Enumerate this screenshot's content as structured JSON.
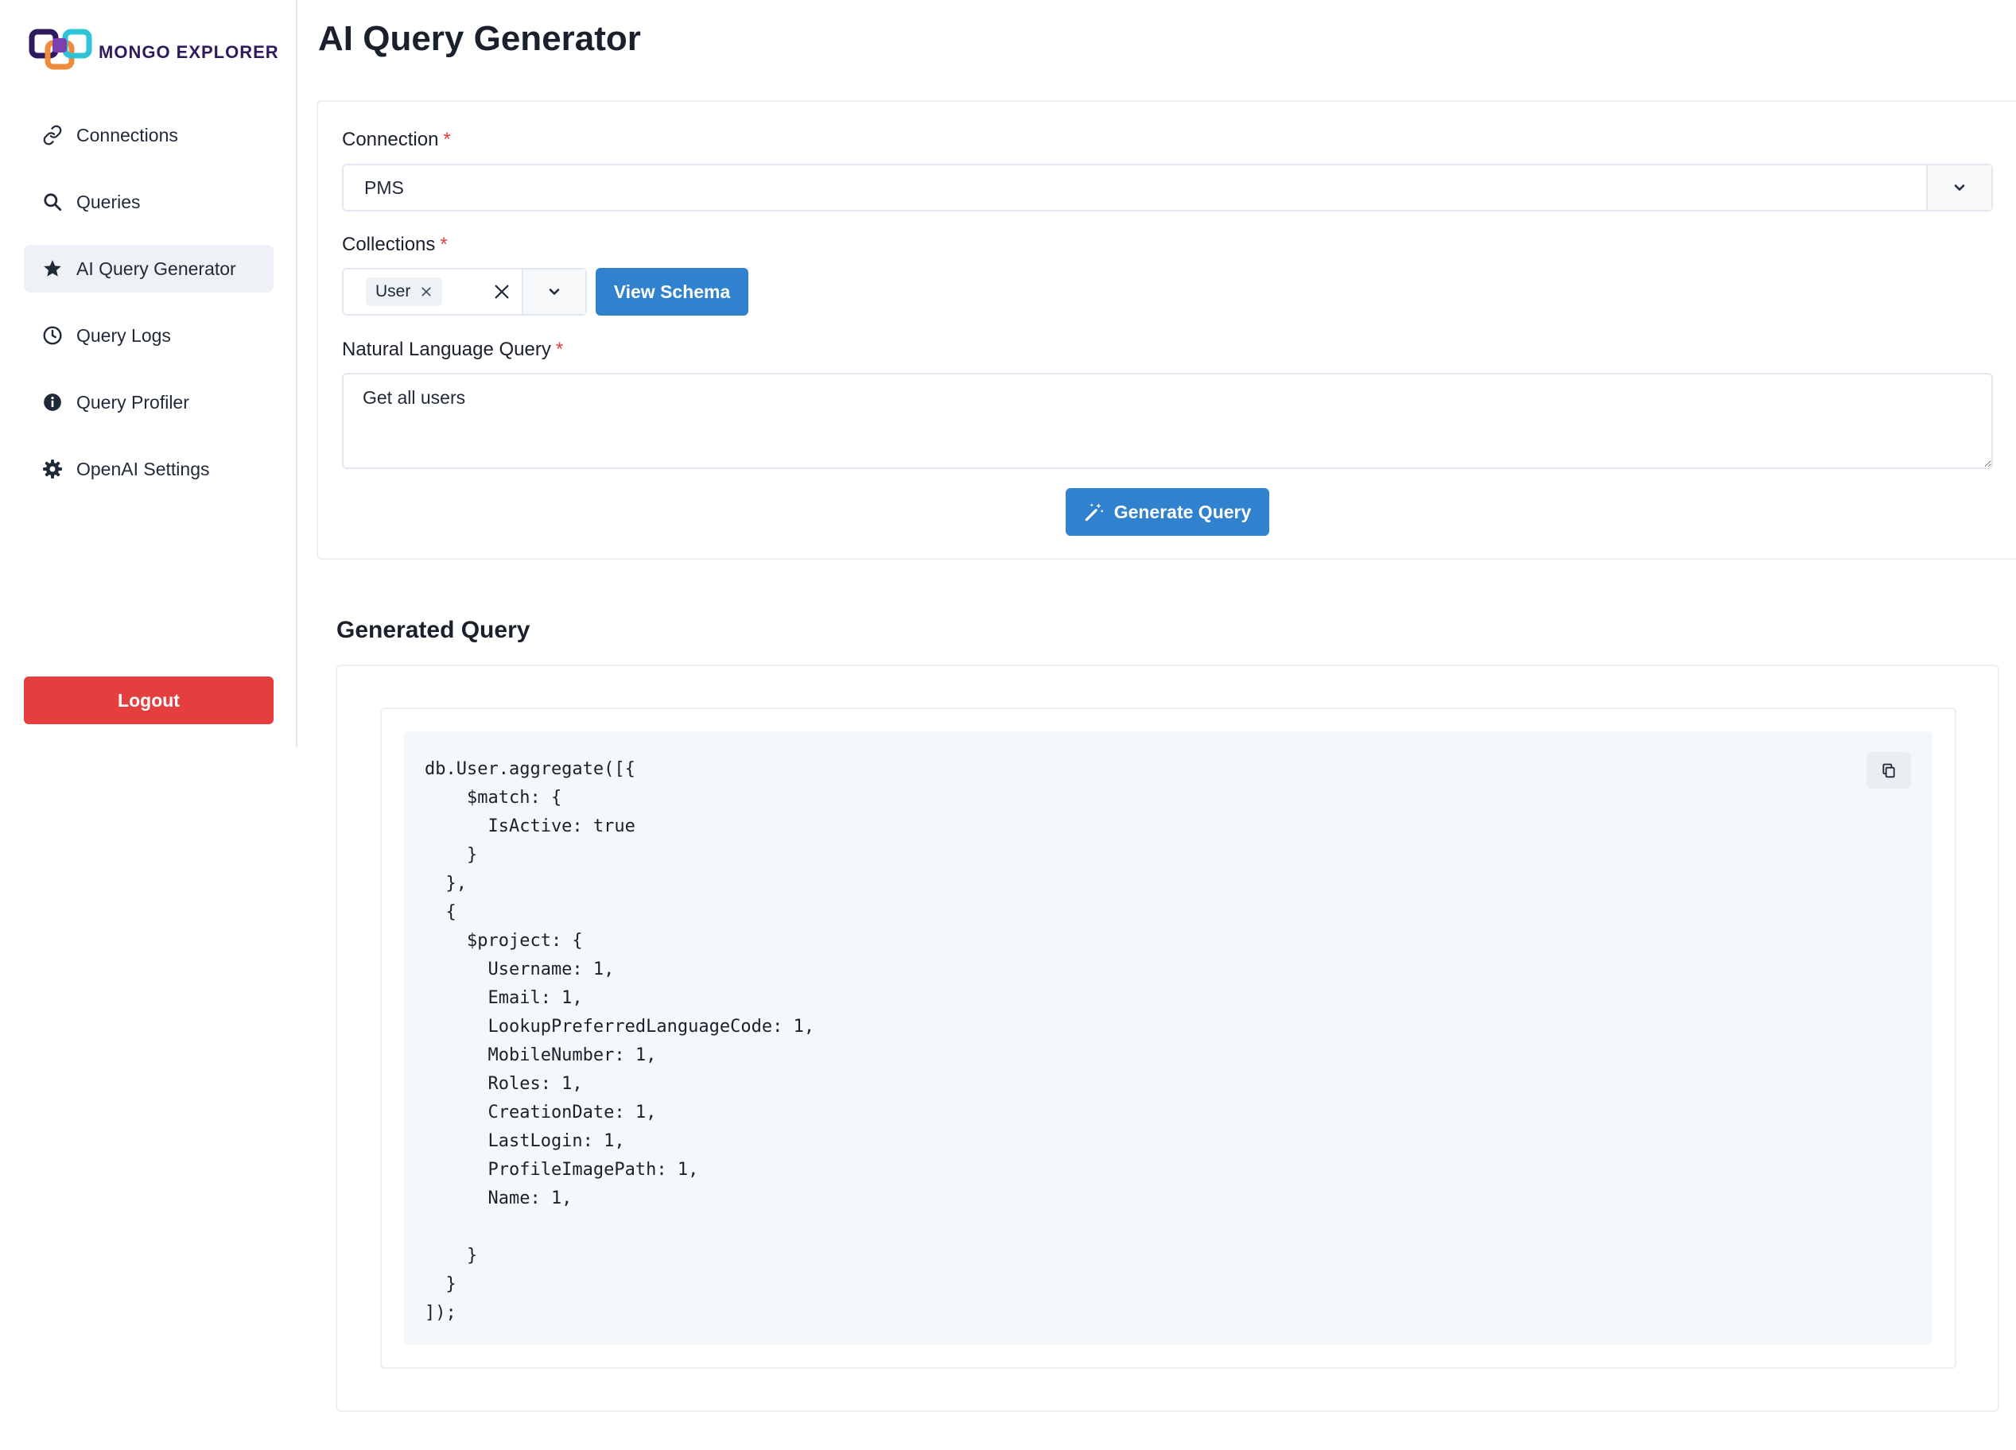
{
  "app": {
    "logo_text": "MONGO EXPLORER"
  },
  "sidebar": {
    "items": [
      {
        "label": "Connections",
        "icon": "link-icon"
      },
      {
        "label": "Queries",
        "icon": "search-icon"
      },
      {
        "label": "AI Query Generator",
        "icon": "star-icon",
        "active": true
      },
      {
        "label": "Query Logs",
        "icon": "clock-icon"
      },
      {
        "label": "Query Profiler",
        "icon": "info-icon"
      },
      {
        "label": "OpenAI Settings",
        "icon": "gear-icon"
      }
    ],
    "logout_label": "Logout"
  },
  "main": {
    "title": "AI Query Generator",
    "connection": {
      "label": "Connection",
      "required_mark": "*",
      "value": "PMS"
    },
    "collections": {
      "label": "Collections",
      "required_mark": "*",
      "chips": [
        "User"
      ],
      "view_schema_label": "View Schema"
    },
    "nl_query": {
      "label": "Natural Language Query",
      "required_mark": "*",
      "value": "Get all users"
    },
    "generate_label": "Generate Query",
    "result": {
      "title": "Generated Query",
      "code": "db.User.aggregate([{\n    $match: {\n      IsActive: true\n    }\n  },\n  {\n    $project: {\n      Username: 1,\n      Email: 1,\n      LookupPreferredLanguageCode: 1,\n      MobileNumber: 1,\n      Roles: 1,\n      CreationDate: 1,\n      LastLogin: 1,\n      ProfileImagePath: 1,\n      Name: 1,\n\n    }\n  }\n]);"
    }
  },
  "colors": {
    "primary": "#3182ce",
    "danger": "#e53e3e",
    "active_nav_bg": "#eef1f5",
    "code_bg": "#f5f8fa"
  }
}
